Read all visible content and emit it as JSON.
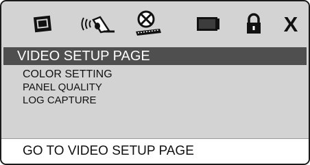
{
  "icons": [
    "general-setup-icon",
    "audio-speaker-icon",
    "video-reel-icon",
    "tv-screen-icon",
    "lock-icon",
    "close-icon"
  ],
  "close_label": "X",
  "page_title": "VIDEO SETUP PAGE",
  "menu": {
    "items": [
      "COLOR SETTING",
      "PANEL QUALITY",
      "LOG CAPTURE"
    ]
  },
  "status": {
    "text": "GO TO VIDEO SETUP PAGE"
  },
  "colors": {
    "panel": "#d3d3d3",
    "title_bar": "#4f4f4f",
    "status_bar": "#ffffff"
  }
}
